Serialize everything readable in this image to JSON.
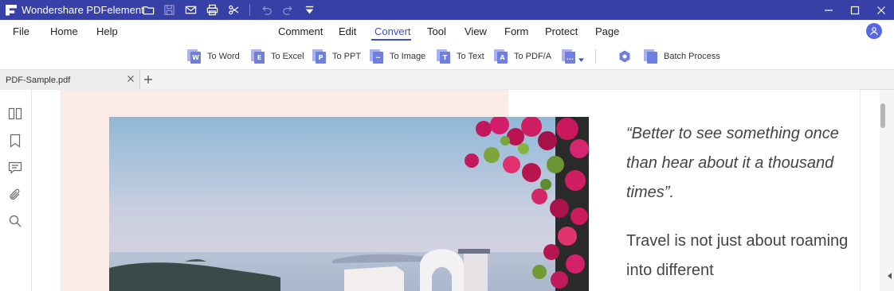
{
  "app": {
    "title": "Wondershare PDFelement"
  },
  "titlebar": {
    "icons": [
      "folder-icon",
      "save-icon",
      "mail-icon",
      "print-icon",
      "scissors-icon",
      "undo-icon",
      "redo-icon",
      "customize-dropdown-icon"
    ],
    "window_controls": [
      "minimize-icon",
      "maximize-icon",
      "close-icon"
    ],
    "background": "#3640a6"
  },
  "menu": {
    "left": [
      "File",
      "Home",
      "Help"
    ],
    "center": [
      "Comment",
      "Edit",
      "Convert",
      "Tool",
      "View",
      "Form",
      "Protect",
      "Page"
    ],
    "active": "Convert",
    "accent": "#3c4fc4"
  },
  "convert_toolbar": {
    "items": [
      {
        "label": "To Word",
        "glyph": "W"
      },
      {
        "label": "To Excel",
        "glyph": "E"
      },
      {
        "label": "To PPT",
        "glyph": "P"
      },
      {
        "label": "To Image",
        "glyph": "~"
      },
      {
        "label": "To Text",
        "glyph": "T"
      },
      {
        "label": "To PDF/A",
        "glyph": "A"
      },
      {
        "label": "",
        "glyph": "..."
      }
    ],
    "batch_label": "Batch Process"
  },
  "tabs": {
    "open": [
      "PDF-Sample.pdf"
    ]
  },
  "sidebar": {
    "icons": [
      "thumbnails-icon",
      "bookmark-icon",
      "comment-icon",
      "attachment-icon",
      "search-icon"
    ]
  },
  "document": {
    "quote": "“Better to see something once than hear about it a thousand times”.",
    "body": "Travel is not just about roaming into different"
  }
}
